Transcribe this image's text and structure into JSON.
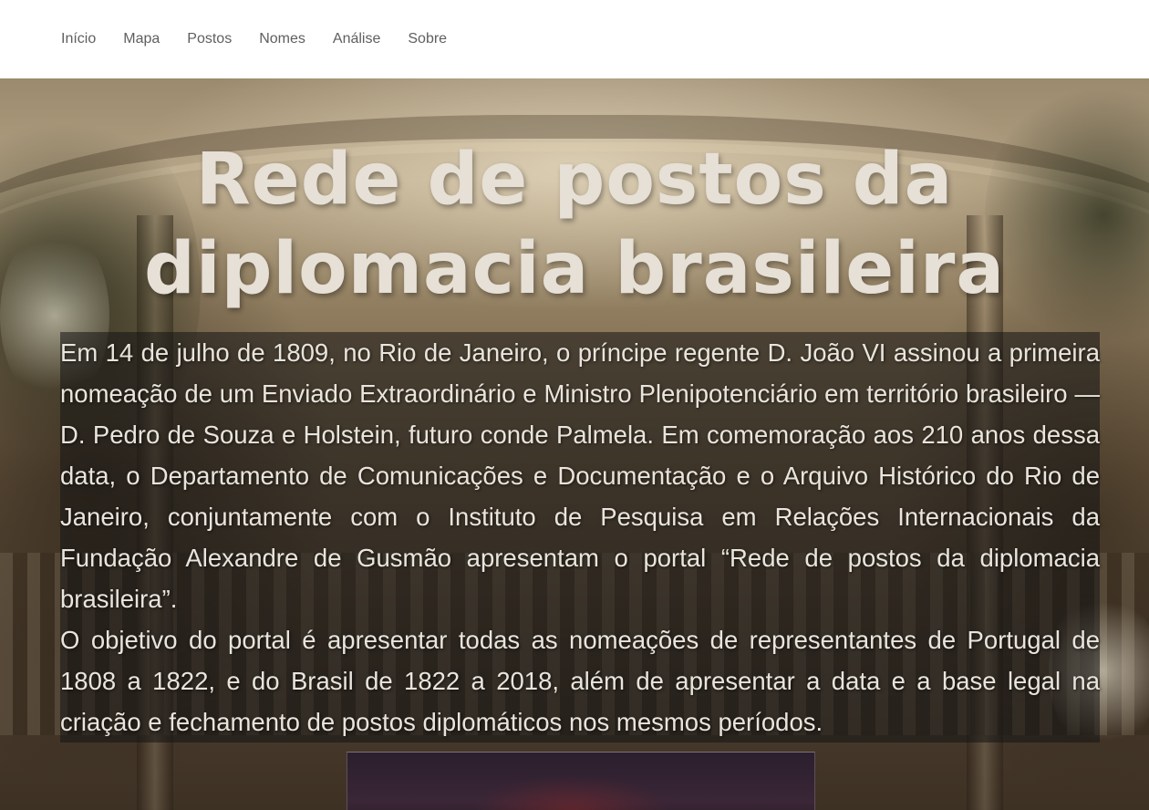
{
  "nav": {
    "items": [
      {
        "label": "Início"
      },
      {
        "label": "Mapa"
      },
      {
        "label": "Postos"
      },
      {
        "label": "Nomes"
      },
      {
        "label": "Análise"
      },
      {
        "label": "Sobre"
      }
    ]
  },
  "hero": {
    "title_line1": "Rede de postos da",
    "title_line2": "diplomacia brasileira",
    "paragraphs": [
      "Em 14 de julho de 1809, no Rio de Janeiro, o príncipe regente D. João VI assinou a primeira nomeação de um Enviado Extraordinário e Ministro Plenipotenciário em território brasileiro — D. Pedro de Souza e Holstein, futuro conde Palmela. Em comemoração aos 210 anos dessa data, o Departamento de Comunicações e Documentação e o Arquivo Histórico do Rio de Janeiro, conjuntamente com o Instituto de Pesquisa em Relações Internacionais da Fundação Alexandre de Gusmão apresentam o portal “Rede de postos da diplomacia brasileira”.",
      "O objetivo do portal é apresentar todas as nomeações de representantes de Portugal de 1808 a 1822, e do Brasil de 1822 a 2018, além de apresentar a data e a base legal na criação e fechamento de postos diplomáticos nos mesmos períodos."
    ]
  }
}
